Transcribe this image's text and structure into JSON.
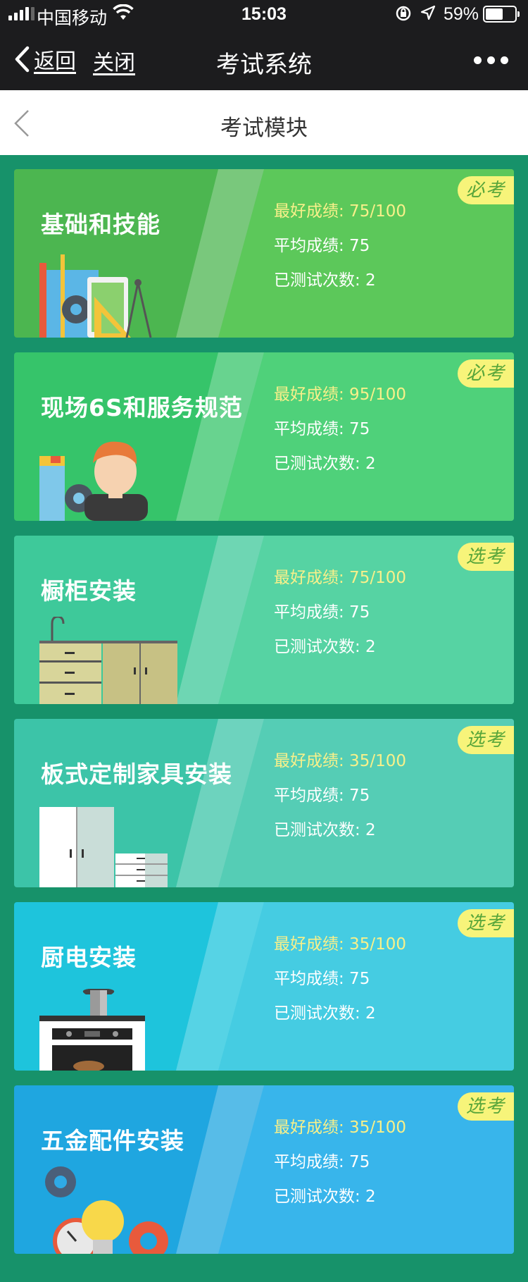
{
  "status_bar": {
    "carrier": "中国移动",
    "time": "15:03",
    "battery": "59%",
    "battery_level": 0.59
  },
  "nav": {
    "back_label": "返回",
    "close_label": "关闭",
    "title": "考试系统"
  },
  "subheader": {
    "title": "考试模块"
  },
  "cards": [
    {
      "name": "基础和技能",
      "badge": "必考",
      "best": "最好成绩: 75/100",
      "avg": "平均成绩: 75",
      "count": "已测试次数: 2",
      "color_left": "#4cb650",
      "color_right": "#5cc85a",
      "illustration": "tools-illustration"
    },
    {
      "name": "现场6S和服务规范",
      "badge": "必考",
      "best": "最好成绩: 95/100",
      "avg": "平均成绩: 75",
      "count": "已测试次数: 2",
      "color_left": "#36c46a",
      "color_right": "#4fd17a",
      "illustration": "worker-illustration"
    },
    {
      "name": "橱柜安装",
      "badge": "选考",
      "best": "最好成绩: 75/100",
      "avg": "平均成绩: 75",
      "count": "已测试次数: 2",
      "color_left": "#3ec99a",
      "color_right": "#56d3a3",
      "illustration": "cabinet-illustration"
    },
    {
      "name": "板式定制家具安装",
      "badge": "选考",
      "best": "最好成绩: 35/100",
      "avg": "平均成绩: 75",
      "count": "已测试次数: 2",
      "color_left": "#3cc4a8",
      "color_right": "#55cdb5",
      "illustration": "wardrobe-illustration"
    },
    {
      "name": "厨电安装",
      "badge": "选考",
      "best": "最好成绩: 35/100",
      "avg": "平均成绩: 75",
      "count": "已测试次数: 2",
      "color_left": "#1ec4dc",
      "color_right": "#45cce2",
      "illustration": "stove-illustration"
    },
    {
      "name": "五金配件安装",
      "badge": "选考",
      "best": "最好成绩: 35/100",
      "avg": "平均成绩: 75",
      "count": "已测试次数: 2",
      "color_left": "#1fa6e0",
      "color_right": "#38b5eb",
      "illustration": "hardware-illustration"
    }
  ]
}
